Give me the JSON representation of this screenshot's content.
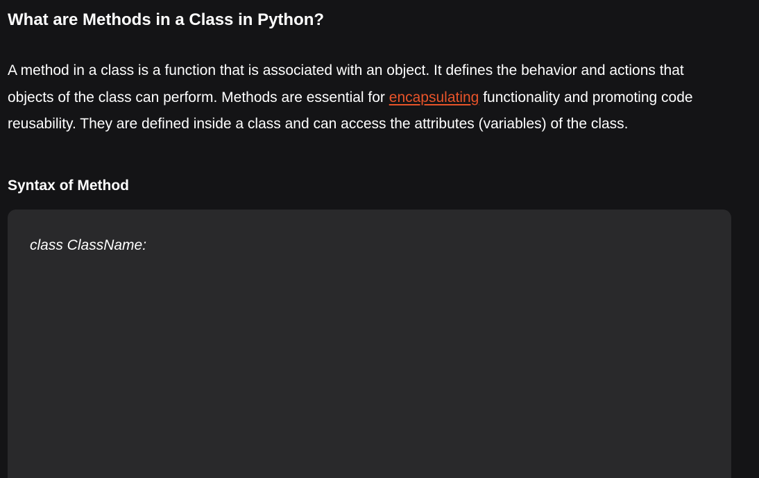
{
  "article": {
    "title": "What are Methods in a Class in Python?",
    "intro": {
      "before_link": "A method in a class is a function that is associated with an object. It defines the behavior and actions that objects of the class can perform. Methods are essential for ",
      "link_text": "encapsulating",
      "after_link": " functionality and promoting code reusability. They are defined inside a class and can access the attributes (variables) of the class."
    },
    "syntax_heading": "Syntax of Method",
    "code": {
      "line1": "class ClassName:"
    }
  },
  "colors": {
    "background": "#141416",
    "code_background": "#29292b",
    "text": "#ffffff",
    "link": "#e8542a"
  }
}
